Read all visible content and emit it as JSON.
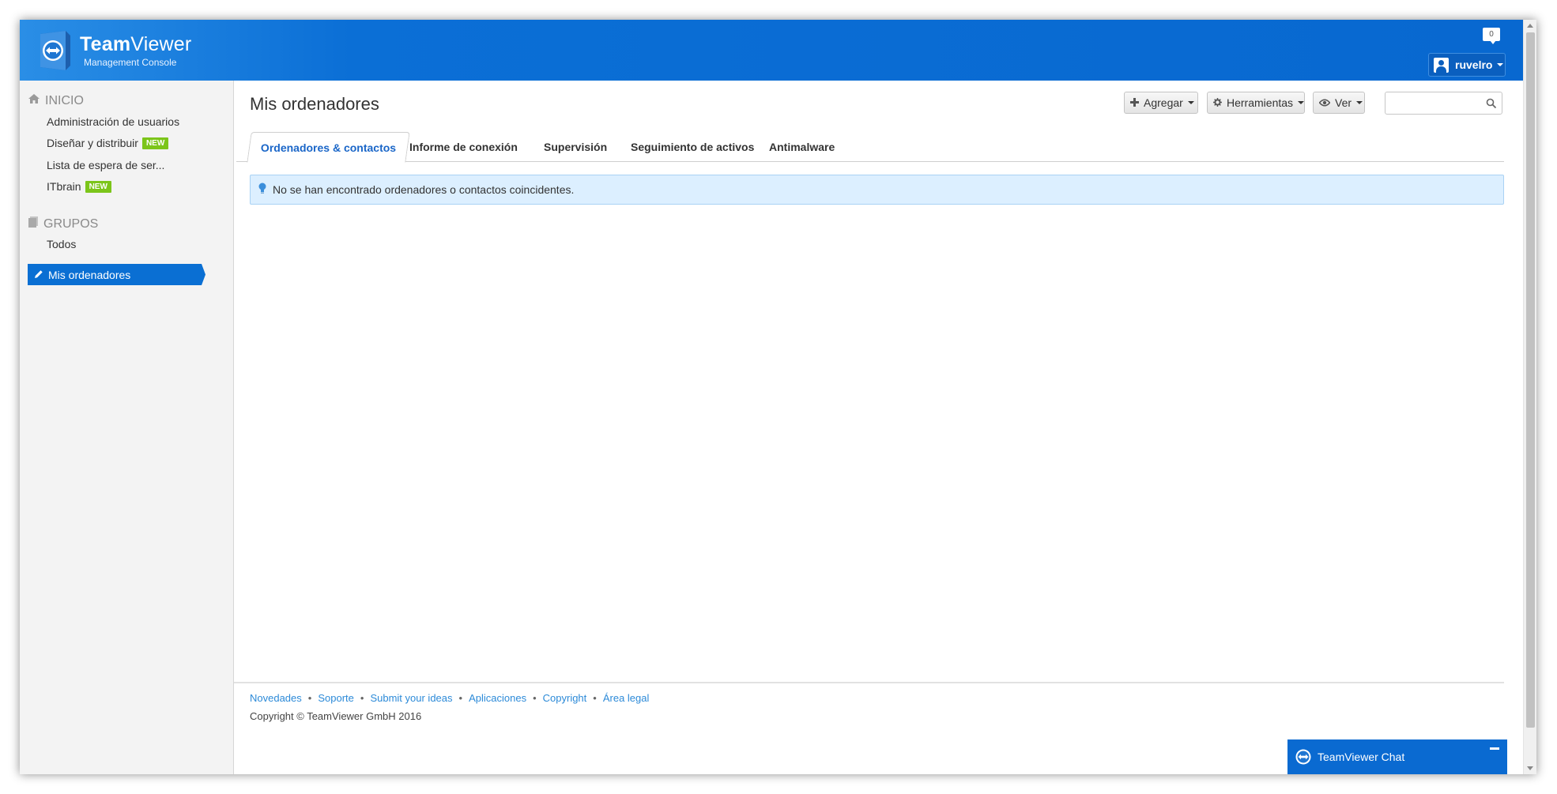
{
  "header": {
    "brand_bold": "Team",
    "brand_rest": "Viewer",
    "subtitle": "Management Console",
    "notification_count": "0",
    "user_name": "ruvelro"
  },
  "sidebar": {
    "home_label": "INICIO",
    "home_items": [
      {
        "label": "Administración de usuarios"
      },
      {
        "label": "Diseñar y distribuir",
        "badge": "NEW"
      },
      {
        "label": "Lista de espera de ser..."
      },
      {
        "label": "ITbrain",
        "badge": "NEW"
      }
    ],
    "groups_label": "GRUPOS",
    "group_items": [
      {
        "label": "Todos"
      },
      {
        "label": "Mis ordenadores",
        "active": true
      }
    ]
  },
  "main": {
    "title": "Mis ordenadores",
    "toolbar": {
      "add_label": "Agregar",
      "tools_label": "Herramientas",
      "view_label": "Ver",
      "search_value": ""
    },
    "tabs": [
      {
        "label": "Ordenadores & contactos",
        "active": true
      },
      {
        "label": "Informe de conexión"
      },
      {
        "label": "Supervisión"
      },
      {
        "label": "Seguimiento de activos"
      },
      {
        "label": "Antimalware"
      }
    ],
    "info_message": "No se han encontrado ordenadores o contactos coincidentes."
  },
  "footer": {
    "links": [
      "Novedades",
      "Soporte",
      "Submit your ideas",
      "Aplicaciones",
      "Copyright",
      "Área legal"
    ],
    "copyright": "Copyright © TeamViewer GmbH 2016"
  },
  "chat": {
    "label": "TeamViewer Chat"
  },
  "colors": {
    "brand_blue": "#0868d0",
    "link_blue": "#2c8ad8",
    "badge_green": "#7cc51a",
    "info_bg": "#dcefff"
  }
}
